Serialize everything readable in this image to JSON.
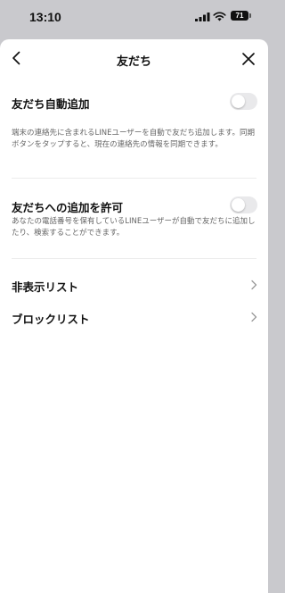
{
  "status_bar": {
    "time": "13:10",
    "battery": "71"
  },
  "header": {
    "title": "友だち"
  },
  "auto_add": {
    "label": "友だち自動追加",
    "enabled": false,
    "description": "端末の連絡先に含まれるLINEユーザーを自動で友だち追加します。同期ボタンをタップすると、現在の連絡先の情報を同期できます。"
  },
  "allow_add": {
    "label": "友だちへの追加を許可",
    "enabled": false,
    "description": "あなたの電話番号を保有しているLINEユーザーが自動で友だちに追加したり、検索することができます。"
  },
  "links": [
    {
      "label": "非表示リスト"
    },
    {
      "label": "ブロックリスト"
    }
  ],
  "icons": {
    "back": "chevron-left-icon",
    "close": "close-icon",
    "row_arrow": "chevron-right-icon"
  },
  "colors": {
    "toggle_off": "#e9e9eb",
    "text": "#111111",
    "description": "#666666"
  }
}
